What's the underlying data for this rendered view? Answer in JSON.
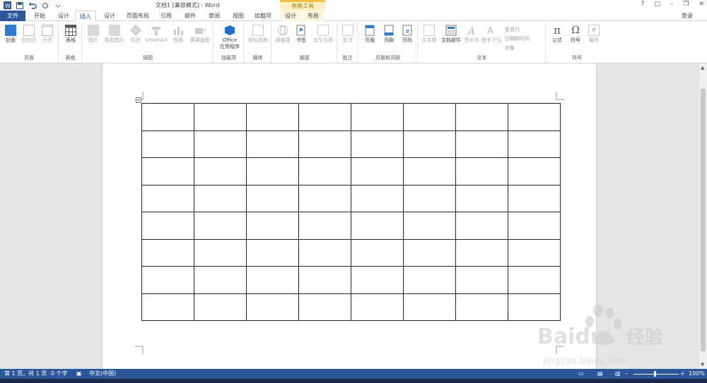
{
  "app": {
    "title": "文档1 [兼容模式] - Word",
    "context_tab_group": "表格工具",
    "login": "登录",
    "window_controls": [
      "?",
      "□",
      "–",
      "❐",
      "✕"
    ]
  },
  "tabs": [
    {
      "label": "文件"
    },
    {
      "label": "开始"
    },
    {
      "label": "设计"
    },
    {
      "label": "插入"
    },
    {
      "label": "设计"
    },
    {
      "label": "页面布局"
    },
    {
      "label": "引用"
    },
    {
      "label": "邮件"
    },
    {
      "label": "审阅"
    },
    {
      "label": "视图"
    },
    {
      "label": "加载项"
    },
    {
      "label": "设计"
    },
    {
      "label": "布局"
    }
  ],
  "ribbon": {
    "groups": [
      {
        "label": "页面",
        "buttons": [
          "封面",
          "空白页",
          "分页"
        ]
      },
      {
        "label": "表格",
        "buttons": [
          "表格"
        ]
      },
      {
        "label": "插图",
        "buttons": [
          "图片",
          "联机图片",
          "形状",
          "SmartArt",
          "图表",
          "屏幕截图"
        ]
      },
      {
        "label": "加载项",
        "buttons": [
          "Office",
          "应用程序"
        ]
      },
      {
        "label": "媒体",
        "buttons": [
          "联机视频"
        ]
      },
      {
        "label": "链接",
        "buttons": [
          "超链接",
          "书签",
          "交叉引用"
        ]
      },
      {
        "label": "批注",
        "buttons": [
          "批注"
        ]
      },
      {
        "label": "页眉和页脚",
        "buttons": [
          "页眉",
          "页脚",
          "页码"
        ]
      },
      {
        "label": "文本",
        "buttons": [
          "文本框",
          "文档部件",
          "艺术字",
          "首字下沉"
        ],
        "small": [
          "签名行",
          "日期和时间",
          "对象"
        ]
      },
      {
        "label": "符号",
        "buttons": [
          "公式",
          "符号",
          "编号"
        ]
      }
    ]
  },
  "document": {
    "table": {
      "rows": 8,
      "cols": 8
    }
  },
  "statusbar": {
    "page": "第 1 页，共 1 页",
    "words": "0 个字",
    "language": "中文(中国)",
    "zoom": "100%"
  },
  "watermark": {
    "brand": "Baidu",
    "suffix": "经验",
    "url": "jingyan.baidu.com"
  },
  "colors": {
    "accent": "#2b579a",
    "context_tab": "#f0c040"
  }
}
